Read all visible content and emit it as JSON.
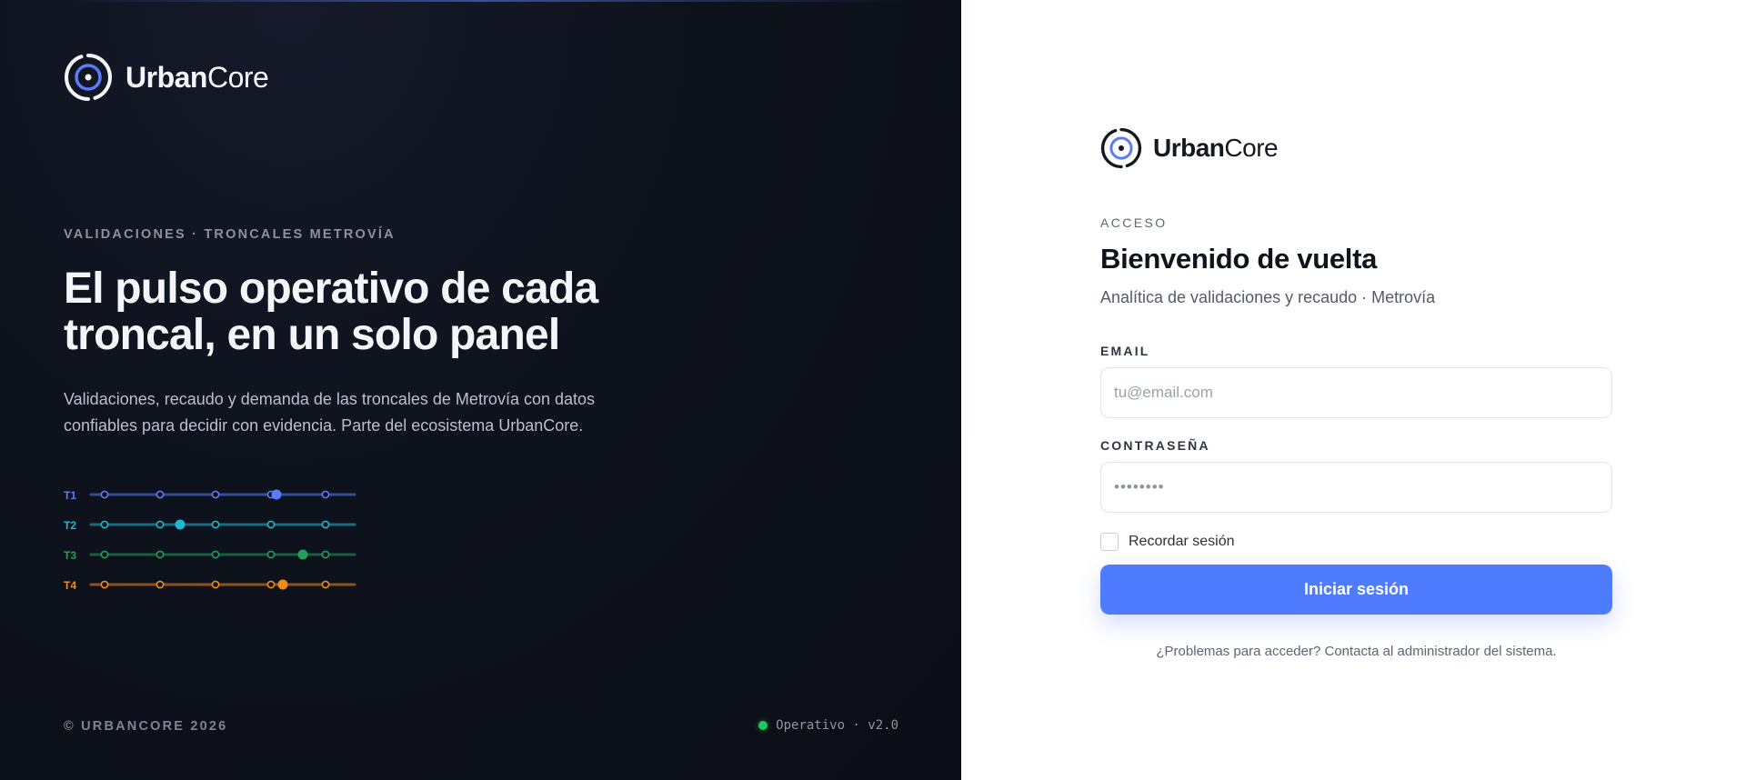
{
  "brand": {
    "name_bold": "Urban",
    "name_light": "Core"
  },
  "hero": {
    "eyebrow": "VALIDACIONES · TRONCALES METROVÍA",
    "headline": "El pulso operativo de cada troncal, en un solo panel",
    "lede": "Validaciones, recaudo y demanda de las troncales de Metrovía con datos confiables para decidir con evidencia. Parte del ecosistema UrbanCore."
  },
  "lines": [
    {
      "label": "T1",
      "color": "#5b7cfa"
    },
    {
      "label": "T2",
      "color": "#22b8cf"
    },
    {
      "label": "T3",
      "color": "#22a05a"
    },
    {
      "label": "T4",
      "color": "#f08c1c"
    }
  ],
  "footer": {
    "copyright": "© URBANCORE 2026",
    "status": "Operativo · v2.0",
    "status_color": "#22c55e"
  },
  "login": {
    "kicker": "ACCESO",
    "title": "Bienvenido de vuelta",
    "subtitle": "Analítica de validaciones y recaudo · Metrovía",
    "email_label": "EMAIL",
    "email_placeholder": "tu@email.com",
    "email_value": "",
    "password_label": "CONTRASEÑA",
    "password_placeholder": "••••••••",
    "password_value": "",
    "remember_label": "Recordar sesión",
    "remember_checked": false,
    "submit_label": "Iniciar sesión",
    "submit_color": "#4f7cff",
    "help_text": "¿Problemas para acceder? Contacta al administrador del sistema."
  }
}
